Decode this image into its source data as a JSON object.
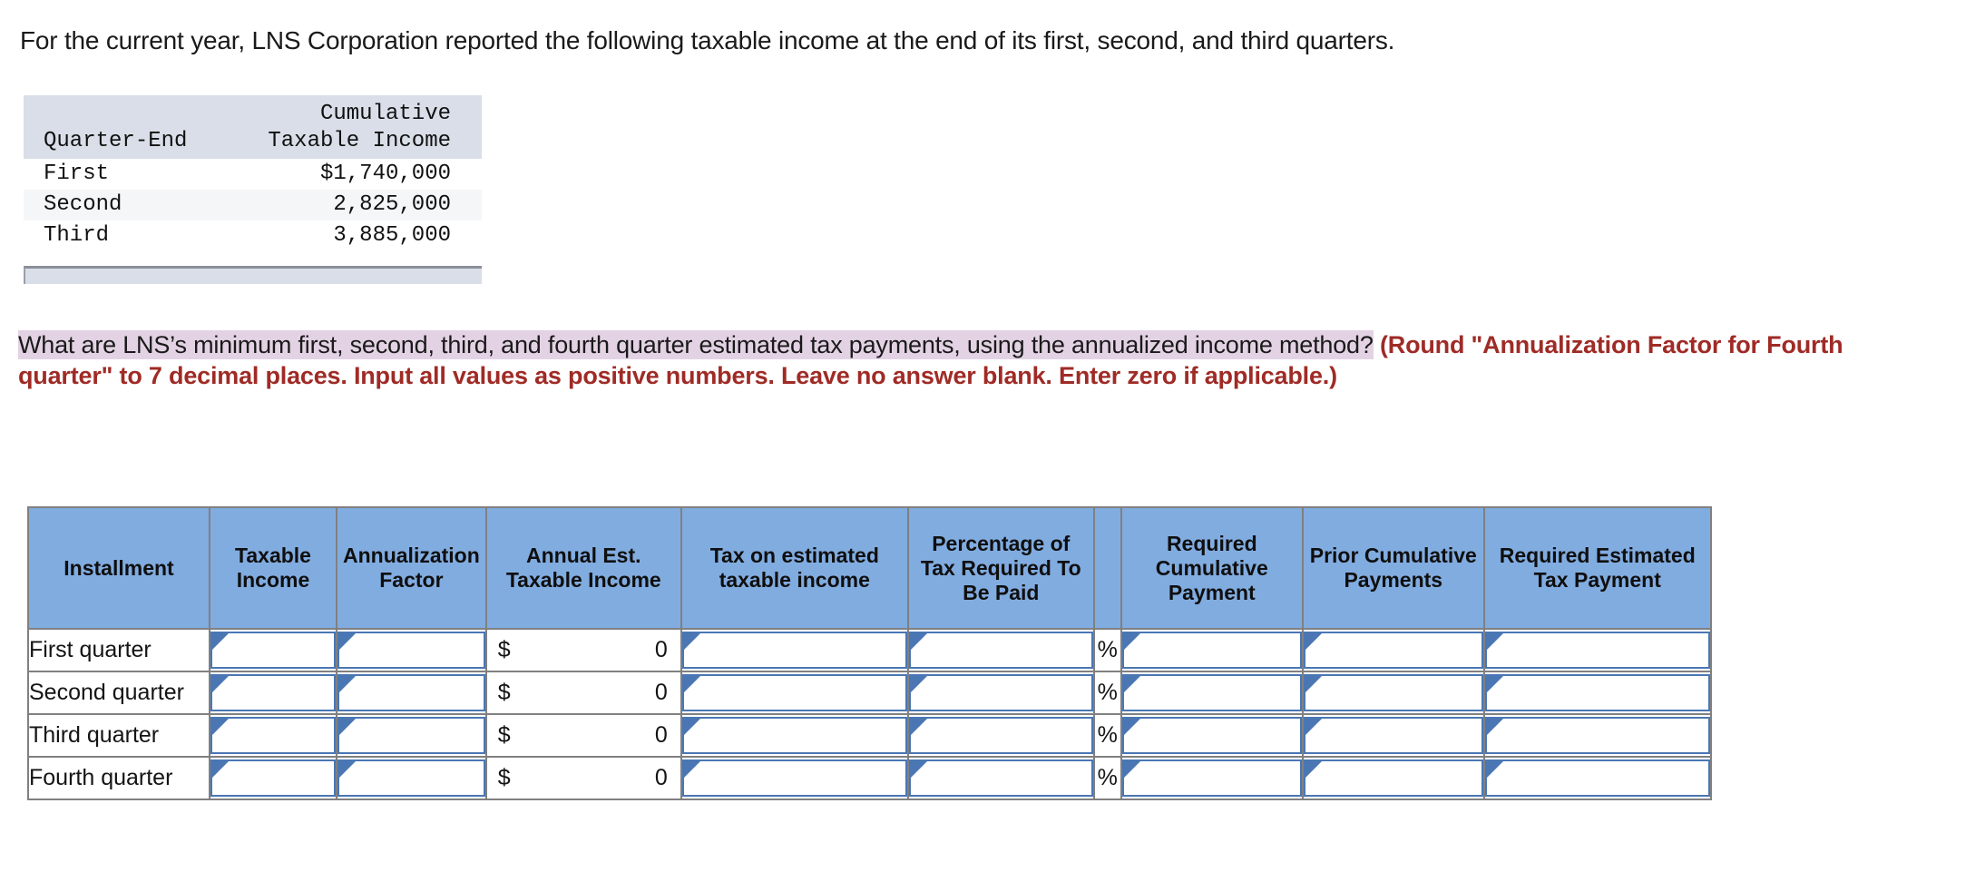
{
  "intro": {
    "text": "For the current year, LNS Corporation reported the following taxable income at the end of its first, second, and third quarters."
  },
  "exhibit": {
    "header": {
      "line1_col1": "",
      "line1_col2": "Cumulative",
      "line2_col1": "Quarter-End",
      "line2_col2": "Taxable Income"
    },
    "rows": [
      {
        "quarter": "First",
        "income": "$1,740,000"
      },
      {
        "quarter": "Second",
        "income": "2,825,000"
      },
      {
        "quarter": "Third",
        "income": "3,885,000"
      }
    ]
  },
  "question": {
    "highlighted": "What are LNS’s minimum first, second, third, and fourth quarter estimated tax payments, using the annualized income method?",
    "instruction": "(Round \"Annualization Factor for Fourth quarter\" to 7 decimal places. Input all values as positive numbers. Leave no answer blank. Enter zero if applicable.)"
  },
  "answer_table": {
    "headers": [
      "Installment",
      "Taxable Income",
      "Annualization Factor",
      "Annual Est. Taxable Income",
      "Tax on estimated taxable income",
      "Percentage of Tax Required To Be Paid",
      "",
      "Required Cumulative Payment",
      "Prior Cumulative Payments",
      "Required Estimated Tax Payment"
    ],
    "rows": [
      {
        "installment": "First quarter",
        "taxable_income": "",
        "annualization_factor": "",
        "annual_est_currency": "$",
        "annual_est_value": "0",
        "tax_on_estimated": "",
        "percentage_required": "",
        "percent_symbol": "%",
        "required_cumulative_payment": "",
        "prior_cumulative_payments": "",
        "required_estimated_tax_payment": ""
      },
      {
        "installment": "Second quarter",
        "taxable_income": "",
        "annualization_factor": "",
        "annual_est_currency": "$",
        "annual_est_value": "0",
        "tax_on_estimated": "",
        "percentage_required": "",
        "percent_symbol": "%",
        "required_cumulative_payment": "",
        "prior_cumulative_payments": "",
        "required_estimated_tax_payment": ""
      },
      {
        "installment": "Third quarter",
        "taxable_income": "",
        "annualization_factor": "",
        "annual_est_currency": "$",
        "annual_est_value": "0",
        "tax_on_estimated": "",
        "percentage_required": "",
        "percent_symbol": "%",
        "required_cumulative_payment": "",
        "prior_cumulative_payments": "",
        "required_estimated_tax_payment": ""
      },
      {
        "installment": "Fourth quarter",
        "taxable_income": "",
        "annualization_factor": "",
        "annual_est_currency": "$",
        "annual_est_value": "0",
        "tax_on_estimated": "",
        "percentage_required": "",
        "percent_symbol": "%",
        "required_cumulative_payment": "",
        "prior_cumulative_payments": "",
        "required_estimated_tax_payment": ""
      }
    ]
  },
  "colors": {
    "header_blue": "#81ace0",
    "highlight_purple": "#e3d2e4",
    "instruction_red": "#9f2b26",
    "exhibit_header_gray": "#d9dee8",
    "input_border_blue": "#4a77b4",
    "table_border_gray": "#808080"
  }
}
